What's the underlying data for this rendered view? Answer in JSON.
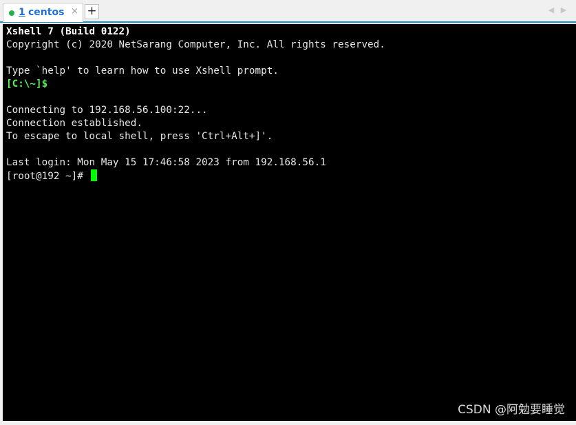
{
  "tabs": [
    {
      "number": "1",
      "title": "centos",
      "close": "×",
      "status_color": "#22b14c"
    }
  ],
  "new_tab_label": "+",
  "nav": {
    "prev": "◀",
    "next": "▶"
  },
  "terminal": {
    "lines": [
      "Xshell 7 (Build 0122)",
      "Copyright (c) 2020 NetSarang Computer, Inc. All rights reserved.",
      "",
      "Type `help' to learn how to use Xshell prompt.",
      "[C:\\~]$",
      "",
      "Connecting to 192.168.56.100:22...",
      "Connection established.",
      "To escape to local shell, press 'Ctrl+Alt+]'.",
      "",
      "Last login: Mon May 15 17:46:58 2023 from 192.168.56.1",
      "[root@192 ~]# "
    ],
    "cursor_color": "#00ff00",
    "background": "#000000"
  },
  "watermark": "CSDN @阿勉要睡觉"
}
